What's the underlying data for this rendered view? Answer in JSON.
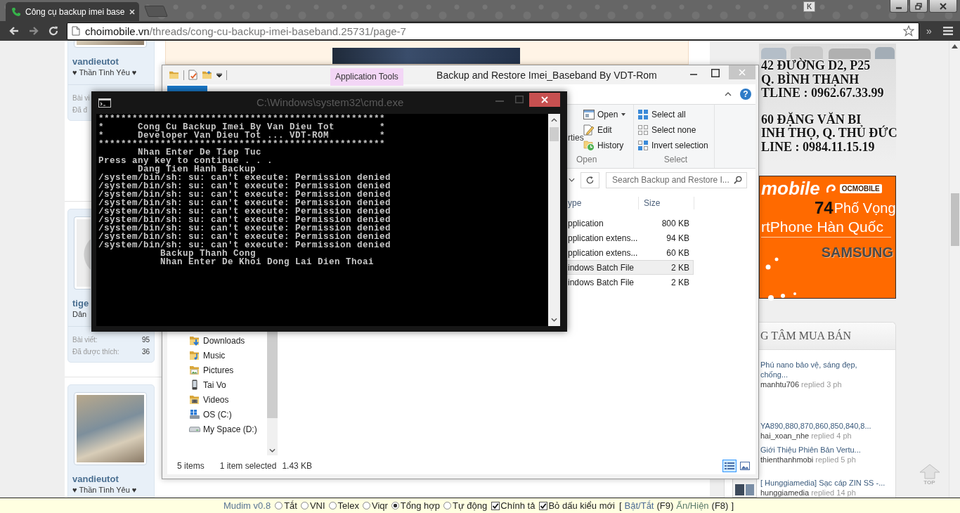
{
  "browser": {
    "tab": {
      "title": "Công cụ backup imei base"
    },
    "extension": "K",
    "address": {
      "domain": "choimobile.vn",
      "path": "/threads/cong-cu-backup-imei-baseband.25731/page-7"
    },
    "overflow": "»"
  },
  "forum": {
    "posters": [
      {
        "kind": "photo",
        "username": "vandieutot",
        "title": "♥ Thần Tình Yêu ♥",
        "stats": [
          {
            "label": "Bài vi"
          },
          {
            "label": "Đã đ"
          }
        ]
      },
      {
        "kind": "default",
        "username": "tige",
        "title": "Dân",
        "stats": [
          {
            "label": "Bài viết:",
            "value": "95"
          },
          {
            "label": "Đã được thích:",
            "value": "36"
          }
        ]
      },
      {
        "kind": "photo",
        "username": "vandieutot",
        "title": "♥ Thần Tình Yêu ♥"
      }
    ]
  },
  "sidebar": {
    "address_ad": {
      "groups": [
        {
          "lines": [
            "42 ĐƯỜNG D2, P25",
            "Q. BÌNH THẠNH",
            "TLINE : 0962.67.33.99"
          ]
        },
        {
          "lines": [
            "60 ĐẶNG VĂN BI",
            "INH THỌ, Q. THỦ ĐỨC",
            "LINE : 0984.11.15.19"
          ]
        }
      ]
    },
    "shop_ad": {
      "brand": "mobile",
      "logo": "OCMOBILE",
      "number": "74",
      "street": "Phố Vọng",
      "tagline": "rtPhone Hàn Quốc",
      "maker": "SAMSUNG"
    },
    "threads": {
      "title": "G TÂM MUA BÁN",
      "items": [
        {
          "title": "Phú nano bảo vệ, sáng đẹp, chống...",
          "author": "manhtu706",
          "time": "replied 3 ph"
        },
        {
          "title": "YA890,880,870,860,850,840,8...",
          "author": "hai_xoan_nhe",
          "time": "replied 4 ph"
        },
        {
          "title": "Giới Thiệu Phiên Bản Vertu...",
          "author": "thienthanhmobi",
          "time": "replied 5 ph"
        },
        {
          "title": "[ Hunggiamedia] Sạc cáp ZIN SS -...",
          "author": "hunggiamedia",
          "time": "replied 14 ph",
          "thumbnail": true
        }
      ]
    },
    "top_button": "TOP"
  },
  "explorer": {
    "context_tab": "Application Tools",
    "title": "Backup and Restore Imei_Baseband By VDT-Rom",
    "help": "?",
    "ribbon": {
      "cut_label": "rties",
      "open_items": [
        {
          "kind": "open",
          "label": "Open",
          "dropdown": true
        },
        {
          "kind": "edit",
          "label": "Edit",
          "dropdown": false
        },
        {
          "kind": "history",
          "label": "History",
          "dropdown": false
        }
      ],
      "open_group": "Open",
      "select_items": [
        {
          "kind": "all",
          "label": "Select all"
        },
        {
          "kind": "none",
          "label": "Select none"
        },
        {
          "kind": "invert",
          "label": "Invert selection"
        }
      ],
      "select_group": "Select"
    },
    "search": {
      "placeholder": "Search Backup and Restore I..."
    },
    "columns": [
      "ype",
      "Size"
    ],
    "files": [
      {
        "type": "pplication",
        "size": "800 KB",
        "selected": false
      },
      {
        "type": "pplication extens...",
        "size": "94 KB",
        "selected": false
      },
      {
        "type": "pplication extens...",
        "size": "60 KB",
        "selected": false
      },
      {
        "type": "indows Batch File",
        "size": "2 KB",
        "selected": true
      },
      {
        "type": "indows Batch File",
        "size": "2 KB",
        "selected": false
      }
    ],
    "nav": [
      {
        "kind": "downloads",
        "label": "Downloads"
      },
      {
        "kind": "music",
        "label": "Music"
      },
      {
        "kind": "pictures",
        "label": "Pictures"
      },
      {
        "kind": "phone",
        "label": "Tai Vo"
      },
      {
        "kind": "videos",
        "label": "Videos"
      },
      {
        "kind": "system-drive",
        "label": "OS (C:)"
      },
      {
        "kind": "drive",
        "label": "My Space (D:)"
      }
    ],
    "status": {
      "count": "5 items",
      "selection": "1 item selected",
      "size": "1.43 KB"
    },
    "views": [
      {
        "kind": "details",
        "selected": true
      },
      {
        "kind": "large-icons",
        "selected": false
      }
    ]
  },
  "console": {
    "title": "C:\\Windows\\system32\\cmd.exe",
    "lines": [
      {
        "kind": "plain",
        "text": "***************************************************"
      },
      {
        "kind": "plain",
        "text": "*      Cong Cu Backup Imei By Van Dieu Tot        *"
      },
      {
        "kind": "plain",
        "text": "*      Developer Van Dieu Tot ... VDT-ROM         *"
      },
      {
        "kind": "plain",
        "text": "***************************************************"
      },
      {
        "kind": "step",
        "text": "Nhan Enter De Tiep Tuc"
      },
      {
        "kind": "plain",
        "text": "Press any key to continue . . ."
      },
      {
        "kind": "step",
        "text": "Dang Tien Hanh Backup"
      },
      {
        "kind": "plain",
        "text": "/system/bin/sh: su: can't execute: Permission denied"
      },
      {
        "kind": "plain",
        "text": "/system/bin/sh: su: can't execute: Permission denied"
      },
      {
        "kind": "plain",
        "text": "/system/bin/sh: su: can't execute: Permission denied"
      },
      {
        "kind": "plain",
        "text": "/system/bin/sh: su: can't execute: Permission denied"
      },
      {
        "kind": "plain",
        "text": "/system/bin/sh: su: can't execute: Permission denied"
      },
      {
        "kind": "plain",
        "text": "/system/bin/sh: su: can't execute: Permission denied"
      },
      {
        "kind": "plain",
        "text": "/system/bin/sh: su: can't execute: Permission denied"
      },
      {
        "kind": "plain",
        "text": "/system/bin/sh: su: can't execute: Permission denied"
      },
      {
        "kind": "plain",
        "text": "/system/bin/sh: su: can't execute: Permission denied"
      },
      {
        "kind": "result",
        "text": "Backup Thanh Cong"
      },
      {
        "kind": "result",
        "text": "Nhan Enter De Khoi Dong Lai Dien Thoai"
      }
    ]
  },
  "mudim": {
    "name": "Mudim v0.8",
    "modes": [
      {
        "label": "Tắt",
        "selected": false
      },
      {
        "label": "VNI",
        "selected": false
      },
      {
        "label": "Telex",
        "selected": false
      },
      {
        "label": "Viqr",
        "selected": false
      },
      {
        "label": "Tổng hợp",
        "selected": true
      },
      {
        "label": "Tự động",
        "selected": false
      }
    ],
    "options": [
      {
        "label": "Chính tả",
        "checked": true
      },
      {
        "label": "Bỏ dấu kiểu mới",
        "checked": true
      }
    ],
    "open_bracket": "[",
    "links": [
      {
        "label": "Bật/Tắt",
        "key": "(F9)"
      },
      {
        "label": "Ấn/Hiện",
        "key": "(F8)"
      }
    ],
    "close_bracket": "]"
  }
}
